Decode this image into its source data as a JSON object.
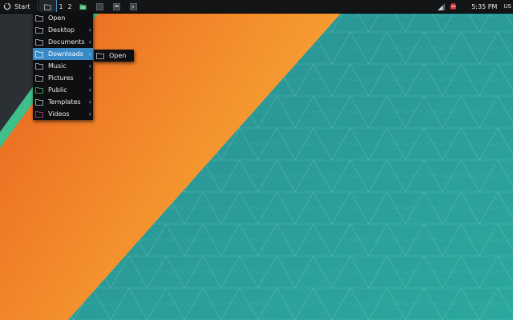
{
  "panel": {
    "start_label": "Start",
    "workspaces": [
      "1",
      "2"
    ],
    "clock": "5:35 PM",
    "keyboard_layout": "US"
  },
  "places_menu": {
    "items": [
      {
        "label": "Open",
        "submenu": false,
        "icon": "folder-icon"
      },
      {
        "label": "Desktop",
        "submenu": true,
        "icon": "folder-icon"
      },
      {
        "label": "Documents",
        "submenu": true,
        "icon": "folder-icon"
      },
      {
        "label": "Downloads",
        "submenu": true,
        "icon": "folder-icon",
        "highlighted": true
      },
      {
        "label": "Music",
        "submenu": true,
        "icon": "folder-icon"
      },
      {
        "label": "Pictures",
        "submenu": true,
        "icon": "folder-icon"
      },
      {
        "label": "Public",
        "submenu": true,
        "icon": "folder-icon"
      },
      {
        "label": "Templates",
        "submenu": true,
        "icon": "folder-icon"
      },
      {
        "label": "Videos",
        "submenu": true,
        "icon": "folder-icon"
      }
    ]
  },
  "downloads_submenu": {
    "items": [
      {
        "label": "Open",
        "icon": "folder-icon"
      }
    ]
  },
  "colors": {
    "panel_bg": "#121416",
    "menu_bg": "#0d0f11",
    "highlight": "#3a8ac7",
    "wallpaper_teal": "#2a9ea0",
    "wallpaper_orange": "#f08a2c",
    "wallpaper_dark": "#2b3035",
    "wallpaper_green": "#3fbf8a"
  }
}
